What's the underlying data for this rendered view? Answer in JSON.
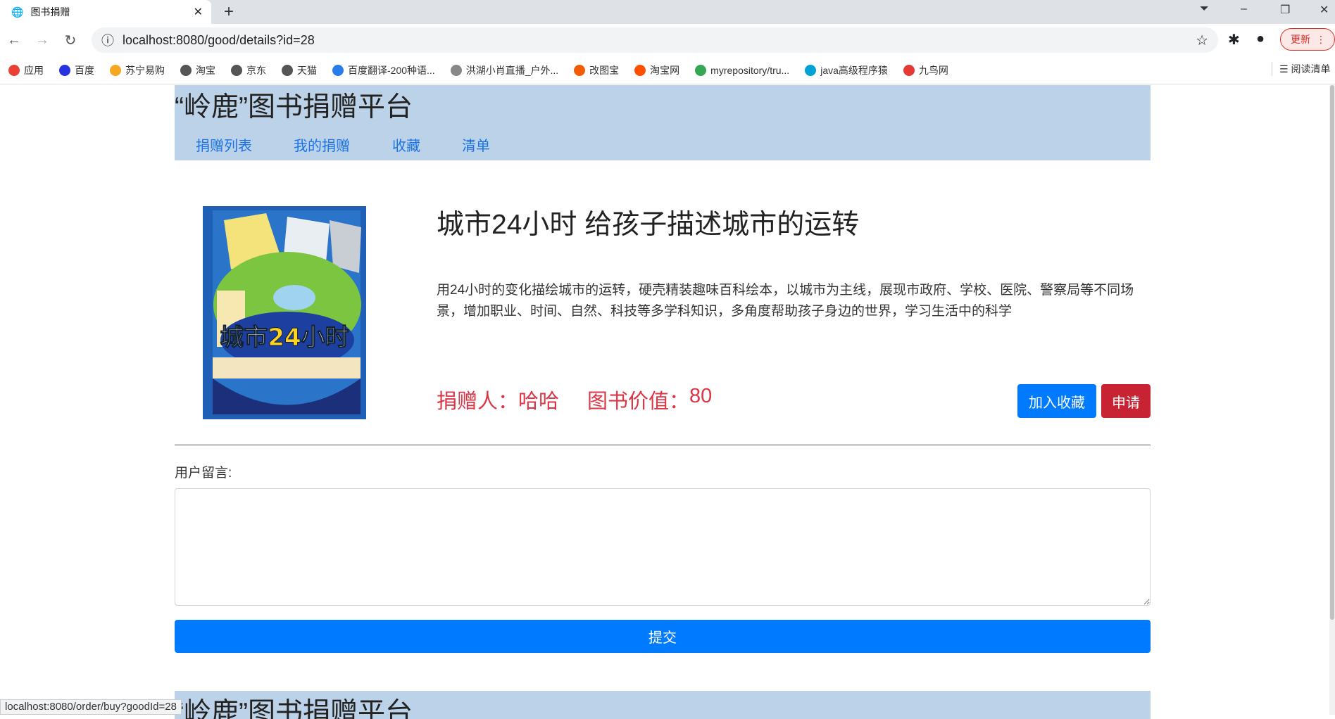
{
  "browser": {
    "tab_title": "图书捐赠",
    "url": "localhost:8080/good/details?id=28",
    "update_label": "更新",
    "bookmarks": [
      {
        "label": "应用",
        "color": "#e94235"
      },
      {
        "label": "百度",
        "color": "#2932e1"
      },
      {
        "label": "苏宁易购",
        "color": "#f5a623"
      },
      {
        "label": "淘宝",
        "color": "#555555"
      },
      {
        "label": "京东",
        "color": "#555555"
      },
      {
        "label": "天猫",
        "color": "#555555"
      },
      {
        "label": "百度翻译-200种语...",
        "color": "#2b7de9"
      },
      {
        "label": "洪湖小肖直播_户外...",
        "color": "#888888"
      },
      {
        "label": "改图宝",
        "color": "#f25c05"
      },
      {
        "label": "淘宝网",
        "color": "#ff5000"
      },
      {
        "label": "myrepository/tru...",
        "color": "#34a853"
      },
      {
        "label": "java高级程序猿",
        "color": "#00a1d6"
      },
      {
        "label": "九鸟网",
        "color": "#e53935"
      }
    ],
    "reading_list": "阅读清单",
    "status_url": "localhost:8080/order/buy?goodId=28"
  },
  "site": {
    "title": "“岭鹿”图书捐赠平台",
    "nav": [
      "捐赠列表",
      "我的捐赠",
      "收藏",
      "清单"
    ]
  },
  "book": {
    "cover_text": "城市24小时",
    "title": "城市24小时 给孩子描述城市的运转",
    "description": "用24小时的变化描绘城市的运转，硬壳精装趣味百科绘本，以城市为主线，展现市政府、学校、医院、警察局等不同场景，增加职业、时间、自然、科技等多学科知识，多角度帮助孩子身边的世界，学习生活中的科学",
    "donor_label": "捐赠人：",
    "donor": "哈哈",
    "value_label": "图书价值：",
    "value": "80",
    "fav_label": "加入收藏",
    "apply_label": "申请"
  },
  "comment": {
    "label": "用户留言:",
    "value": "",
    "submit_label": "提交"
  },
  "colors": {
    "header": "#bcd2e8",
    "primary": "#007bff",
    "danger": "#dc3545"
  }
}
